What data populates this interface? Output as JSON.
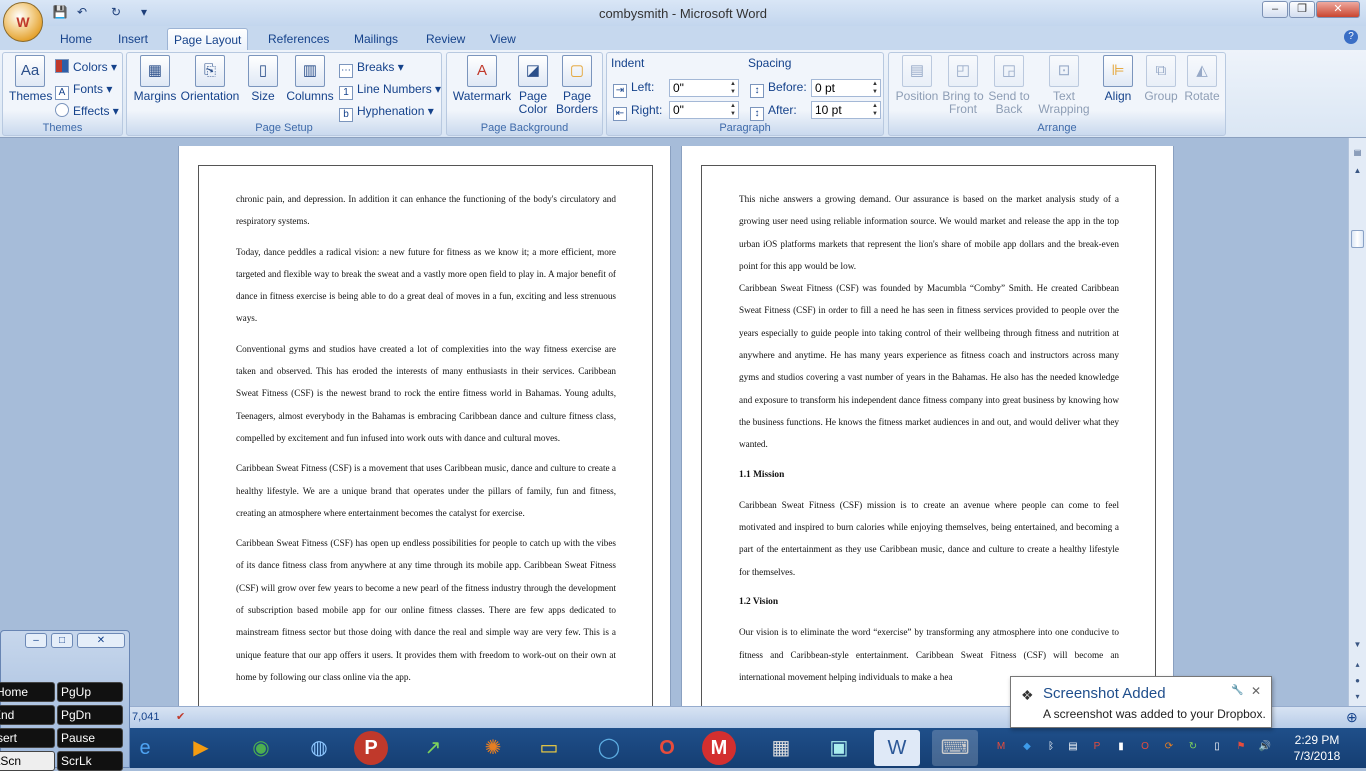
{
  "app": {
    "title": "combysmith - Microsoft Word"
  },
  "qat": {
    "save": "💾",
    "undo": "↶",
    "redo": "↻",
    "more": "▾"
  },
  "window_controls": {
    "minimize": "–",
    "maximize": "❐",
    "close": "✕",
    "help": "?"
  },
  "tabs": [
    {
      "label": "Home"
    },
    {
      "label": "Insert"
    },
    {
      "label": "Page Layout"
    },
    {
      "label": "References"
    },
    {
      "label": "Mailings"
    },
    {
      "label": "Review"
    },
    {
      "label": "View"
    }
  ],
  "ribbon": {
    "themes": {
      "group": "Themes",
      "themes": "Themes",
      "colors": "Colors",
      "fonts": "Fonts",
      "effects": "Effects"
    },
    "page_setup": {
      "group": "Page Setup",
      "margins": "Margins",
      "orientation": "Orientation",
      "size": "Size",
      "columns": "Columns",
      "breaks": "Breaks",
      "line_numbers": "Line Numbers",
      "hyphenation": "Hyphenation"
    },
    "page_background": {
      "group": "Page Background",
      "watermark": "Watermark",
      "page_color_1": "Page",
      "page_color_2": "Color",
      "page_borders_1": "Page",
      "page_borders_2": "Borders"
    },
    "paragraph": {
      "group": "Paragraph",
      "indent": "Indent",
      "spacing": "Spacing",
      "left_label": "Left:",
      "left_value": "0\"",
      "right_label": "Right:",
      "right_value": "0\"",
      "before_label": "Before:",
      "before_value": "0 pt",
      "after_label": "After:",
      "after_value": "10 pt"
    },
    "arrange": {
      "group": "Arrange",
      "position": "Position",
      "bring_to_front_1": "Bring to",
      "bring_to_front_2": "Front",
      "send_to_back_1": "Send to",
      "send_to_back_2": "Back",
      "text_wrapping_1": "Text",
      "text_wrapping_2": "Wrapping",
      "align": "Align",
      "group_btn": "Group",
      "rotate": "Rotate"
    }
  },
  "document": {
    "left_page": [
      "chronic pain, and depression. In addition it can enhance the functioning of the body's circulatory and respiratory systems.",
      "Today, dance peddles a radical vision: a new future for fitness as we know it; a more efficient, more targeted and flexible way to break the sweat and a vastly more open field to play in. A major benefit of dance in fitness exercise is being able to do a great deal of moves in a fun, exciting and less strenuous ways.",
      "Conventional gyms and studios have created a lot of complexities into the way fitness exercise are taken and observed. This has eroded the interests of many enthusiasts in their services. Caribbean Sweat Fitness (CSF) is the newest brand to rock the entire fitness world in Bahamas. Young adults, Teenagers, almost everybody in the Bahamas is embracing Caribbean dance and culture fitness class, compelled by excitement and fun infused into work outs with dance and cultural moves.",
      "Caribbean Sweat Fitness (CSF) is a movement that uses Caribbean music, dance and culture to create a healthy lifestyle. We are a unique brand that operates under the pillars of family, fun and fitness, creating an atmosphere where entertainment becomes the catalyst for exercise.",
      "Caribbean Sweat Fitness (CSF) has open up endless possibilities for people to catch up with the vibes of its dance fitness class from anywhere at any time through its mobile app. Caribbean Sweat Fitness (CSF) will grow over few years to become a new pearl of the fitness industry through the development of subscription based mobile app for our online fitness classes. There are few apps dedicated to mainstream fitness sector but those doing with dance the real and simple way are very few. This is a unique feature that our app offers it users. It provides them with freedom to work-out on their own at home by following our class online via the app."
    ],
    "right_p1": "This niche answers a growing demand. Our assurance is based on the market analysis study of a growing user need using reliable information source. We would market and release the app in the top urban iOS platforms markets that represent the lion's share of mobile app dollars and the break-even point for this app would be low.",
    "right_p2": " Caribbean Sweat Fitness (CSF) was founded by Macumbla “Comby” Smith.  He created Caribbean Sweat Fitness (CSF) in order to fill a need he has seen in fitness services provided to people over the years especially to guide people into taking control of their wellbeing through fitness and nutrition at anywhere and anytime. He has many years experience as fitness coach and instructors across many gyms and studios covering a vast number of years in the Bahamas. He also has the needed knowledge and exposure to transform his independent dance fitness company into great business by knowing how the business functions. He knows the fitness market audiences in and out, and would deliver what they wanted.",
    "h_mission": "1.1 Mission",
    "mission": "Caribbean Sweat Fitness (CSF) mission is to create an  avenue where people can come to feel motivated and inspired to burn calories while enjoying themselves, being entertained, and becoming a part of the entertainment as they use Caribbean music, dance and culture to create a healthy lifestyle for themselves.",
    "h_vision": "1.2 Vision",
    "vision": "Our vision is to eliminate the word “exercise” by transforming any atmosphere into one conducive to fitness and Caribbean-style entertainment. Caribbean Sweat Fitness (CSF) will become an international movement helping individuals to make a hea"
  },
  "status": {
    "word_count": "7,041"
  },
  "osk": {
    "keys": [
      "Home",
      "PgUp",
      "End",
      "PgDn",
      "Insert",
      "Pause",
      "PrtScn",
      "ScrLk"
    ],
    "btn_min": "–",
    "btn_max": "□",
    "btn_close": "✕"
  },
  "toast": {
    "title": "Screenshot Added",
    "body": "A screenshot was added to your Dropbox.",
    "close": "✕",
    "pin": "🔧"
  },
  "clock": {
    "time": "2:29 PM",
    "date": "7/3/2018"
  }
}
